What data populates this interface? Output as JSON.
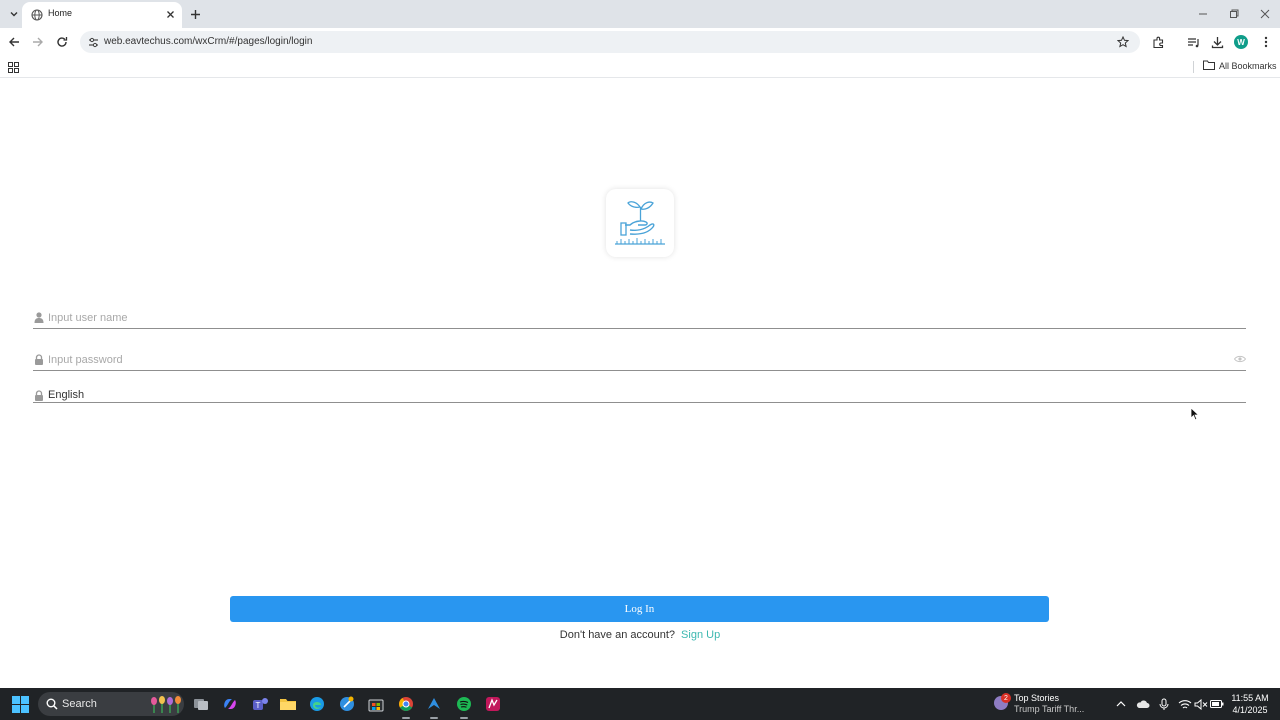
{
  "browser": {
    "tab_title": "Home",
    "url": "web.eavtechus.com/wxCrm/#/pages/login/login",
    "profile_initial": "W",
    "all_bookmarks_label": "All Bookmarks"
  },
  "login": {
    "username_placeholder": "Input user name",
    "password_placeholder": "Input password",
    "language_value": "English",
    "login_button_label": "Log In",
    "signup_prompt": "Don't have an account?",
    "signup_link_label": "Sign Up"
  },
  "taskbar": {
    "search_label": "Search",
    "news_badge": "2",
    "news_title": "Top Stories",
    "news_subtitle": "Trump Tariff Thr...",
    "time": "11:55 AM",
    "date": "4/1/2025"
  },
  "colors": {
    "primary_button": "#2996f0",
    "link": "#3cb8b0",
    "logo_blue": "#4aa3d8"
  },
  "icons": {
    "username_field": "user-icon",
    "password_field": "lock-icon",
    "language_field": "lock-icon",
    "password_visibility": "eye-icon",
    "logo": "plant-in-hand-icon"
  }
}
